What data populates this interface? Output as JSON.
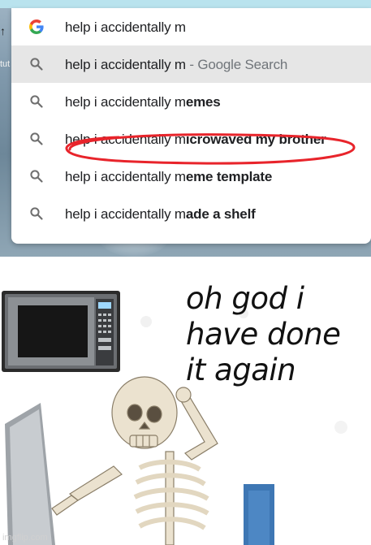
{
  "search_panel": {
    "fragment_arrow": "↑",
    "fragment_text": "tut",
    "suggestions": [
      {
        "icon": "google-g-icon",
        "typed": "help i accidentally m",
        "completion": "",
        "suffix": ""
      },
      {
        "icon": "search-icon",
        "typed": "help i accidentally m",
        "completion": "",
        "suffix": " - Google Search"
      },
      {
        "icon": "search-icon",
        "typed": "help i accidentally m",
        "completion": "emes",
        "suffix": ""
      },
      {
        "icon": "search-icon",
        "typed": "help i accidentally m",
        "completion": "icrowaved my brother",
        "suffix": ""
      },
      {
        "icon": "search-icon",
        "typed": "help i accidentally m",
        "completion": "eme template",
        "suffix": ""
      },
      {
        "icon": "search-icon",
        "typed": "help i accidentally m",
        "completion": "ade a shelf",
        "suffix": ""
      }
    ],
    "highlight_color": "#e8242b"
  },
  "meme": {
    "caption_lines": [
      "oh god i",
      "have done",
      "it again"
    ],
    "watermark": "imgflip.com"
  }
}
